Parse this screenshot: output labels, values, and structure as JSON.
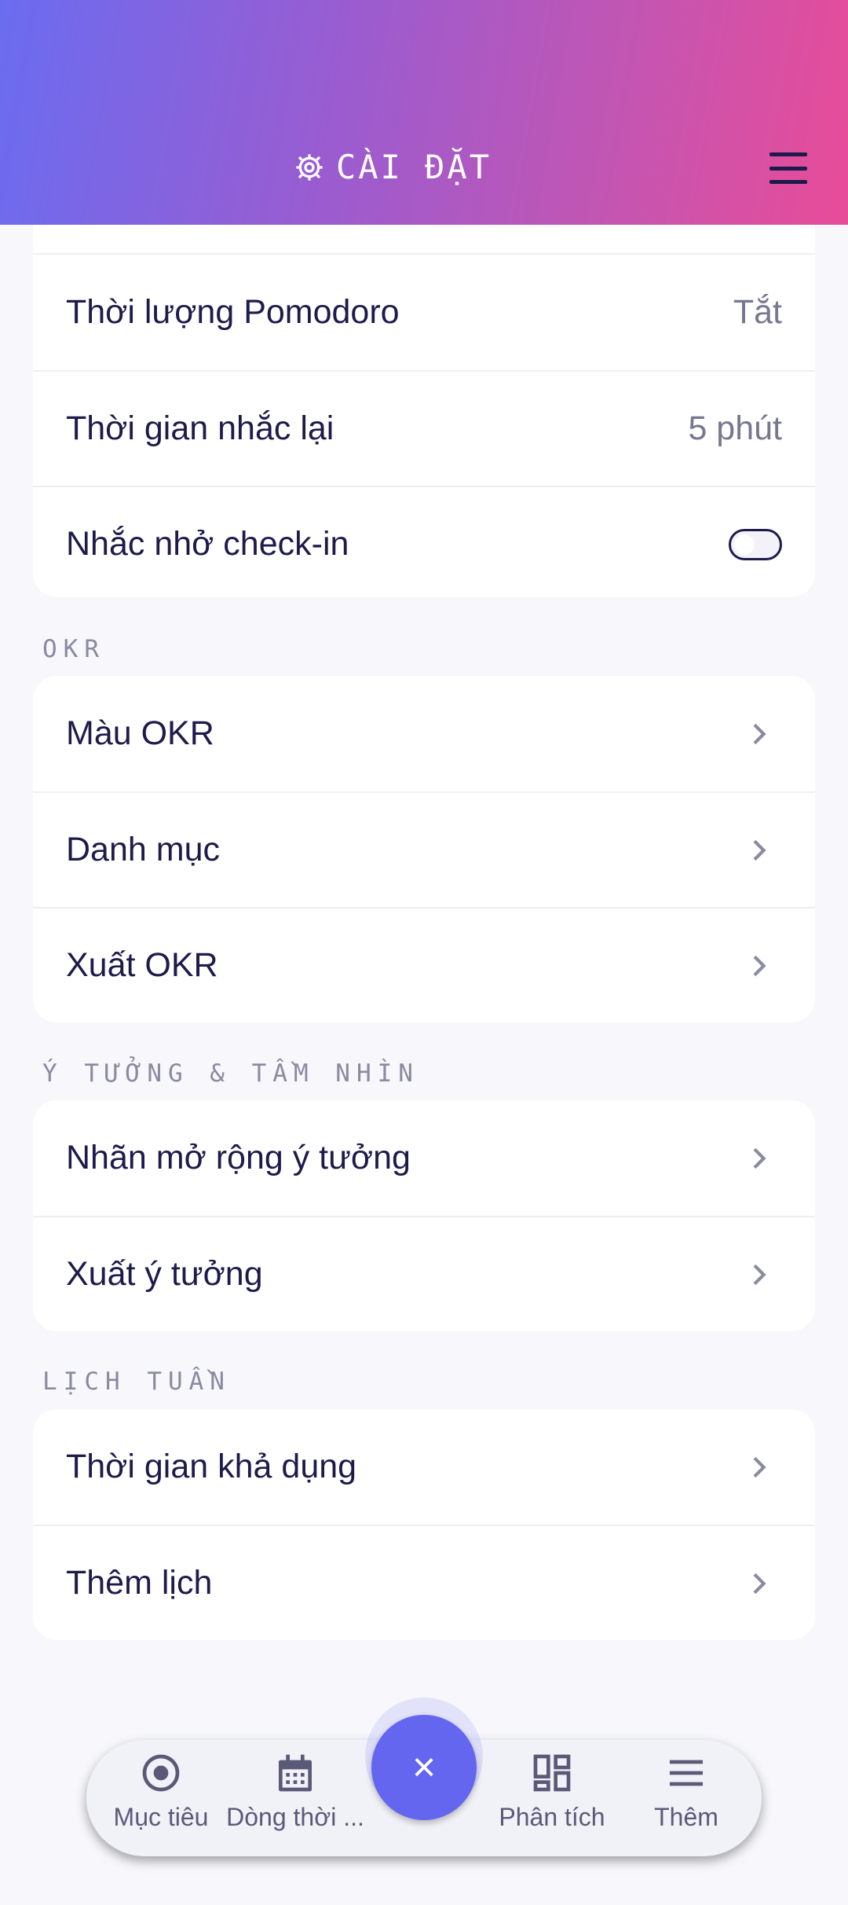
{
  "header": {
    "title": "CÀI ĐẶT",
    "icon": "gear-icon",
    "menu_icon": "hamburger-icon"
  },
  "timer_section": {
    "rows": [
      {
        "label": "Thời lượng Pomodoro",
        "value": "Tắt"
      },
      {
        "label": "Thời gian nhắc lại",
        "value": "5 phút"
      },
      {
        "label": "Nhắc nhở check-in",
        "toggle": false
      }
    ]
  },
  "okr_section": {
    "label": "OKR",
    "rows": [
      {
        "label": "Màu OKR"
      },
      {
        "label": "Danh mục"
      },
      {
        "label": "Xuất OKR"
      }
    ]
  },
  "ideas_section": {
    "label": "Ý TƯỞNG & TẦM NHÌN",
    "rows": [
      {
        "label": "Nhãn mở rộng ý tưởng"
      },
      {
        "label": "Xuất ý tưởng"
      }
    ]
  },
  "schedule_section": {
    "label": "LỊCH TUẦN",
    "rows": [
      {
        "label": "Thời gian khả dụng"
      },
      {
        "label": "Thêm lịch"
      }
    ]
  },
  "bottom_nav": {
    "items": [
      {
        "label": "Mục tiêu",
        "icon": "target-icon"
      },
      {
        "label": "Dòng thời ...",
        "icon": "calendar-icon"
      },
      {
        "label": "Phân tích",
        "icon": "dashboard-icon"
      },
      {
        "label": "Thêm",
        "icon": "menu-lines-icon"
      }
    ],
    "fab_symbol": "×"
  },
  "colors": {
    "header_gradient_start": "#6a6cf0",
    "header_gradient_end": "#e84c98",
    "fab": "#6466ef",
    "text_primary": "#1e1b4b",
    "text_secondary": "#777790"
  }
}
